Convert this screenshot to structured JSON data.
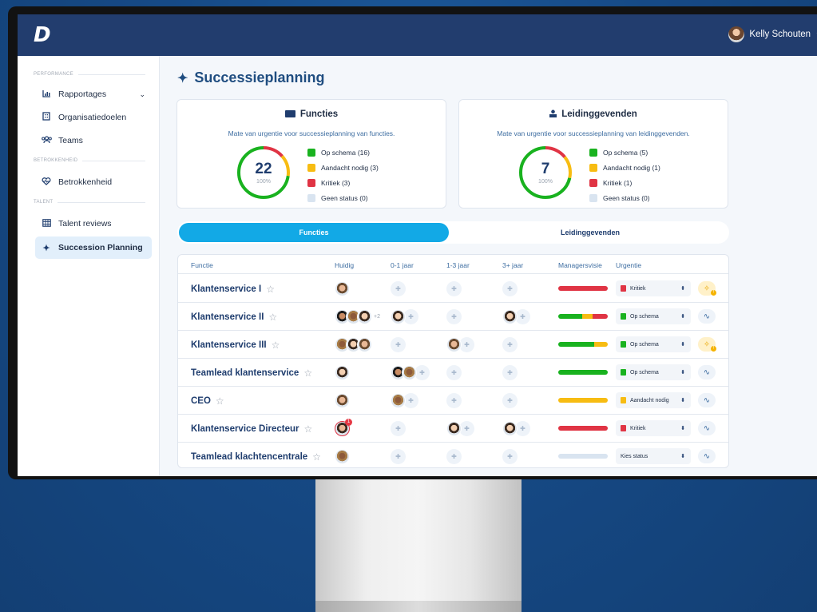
{
  "app": {
    "logo": "D",
    "user_name": "Kelly Schouten"
  },
  "sidebar": {
    "sections": {
      "performance": "PERFORMANCE",
      "betrokkenheid": "BETROKKENHEID",
      "talent": "TALENT"
    },
    "items": [
      {
        "label": "Rapportages",
        "icon": "bar-chart-icon"
      },
      {
        "label": "Organisatiedoelen",
        "icon": "building-icon"
      },
      {
        "label": "Teams",
        "icon": "people-icon"
      },
      {
        "label": "Betrokkenheid",
        "icon": "heart-icon"
      },
      {
        "label": "Talent reviews",
        "icon": "grid-icon"
      },
      {
        "label": "Succession Planning",
        "icon": "sparkle-icon"
      }
    ]
  },
  "page": {
    "title": "Successieplanning"
  },
  "cards": {
    "functies": {
      "title": "Functies",
      "subtitle": "Mate van urgentie voor successieplanning van functies.",
      "total": "22",
      "percent": "100%",
      "legend": [
        "Op schema (16)",
        "Aandacht nodig (3)",
        "Kritiek (3)",
        "Geen status (0)"
      ],
      "counts": {
        "op_schema": 16,
        "aandacht": 3,
        "kritiek": 3,
        "geen": 0
      }
    },
    "leidinggevenden": {
      "title": "Leidinggevenden",
      "subtitle": "Mate van urgentie voor successieplanning van leidinggevenden.",
      "total": "7",
      "percent": "100%",
      "legend": [
        "Op schema (5)",
        "Aandacht nodig (1)",
        "Kritiek (1)",
        "Geen status (0)"
      ],
      "counts": {
        "op_schema": 5,
        "aandacht": 1,
        "kritiek": 1,
        "geen": 0
      }
    }
  },
  "colors": {
    "op_schema": "#19b21f",
    "aandacht": "#f7bc12",
    "kritiek": "#e03444",
    "geen": "#d9e4f0",
    "accent": "#12a9e6"
  },
  "tabs": {
    "functies": "Functies",
    "leidinggevenden": "Leidinggevenden"
  },
  "table": {
    "headers": {
      "functie": "Functie",
      "huidig": "Huidig",
      "y01": "0-1 jaar",
      "y13": "1-3 jaar",
      "y3": "3+ jaar",
      "visie": "Managersvisie",
      "urgentie": "Urgentie"
    },
    "rows": [
      {
        "name": "Klantenservice I",
        "status": "Kritiek",
        "status_key": "kritiek",
        "more": ""
      },
      {
        "name": "Klantenservice II",
        "status": "Op schema",
        "status_key": "op_schema",
        "more": "+2"
      },
      {
        "name": "Klantenservice III",
        "status": "Op schema",
        "status_key": "op_schema",
        "more": ""
      },
      {
        "name": "Teamlead klantenservice",
        "status": "Op schema",
        "status_key": "op_schema",
        "more": ""
      },
      {
        "name": "CEO",
        "status": "Aandacht nodig",
        "status_key": "aandacht",
        "more": ""
      },
      {
        "name": "Klantenservice Directeur",
        "status": "Kritiek",
        "status_key": "kritiek",
        "more": ""
      },
      {
        "name": "Teamlead klachtencentrale",
        "status": "Kies status",
        "status_key": "geen",
        "more": ""
      }
    ]
  },
  "badges": {
    "notification": "1",
    "warning": "!"
  }
}
